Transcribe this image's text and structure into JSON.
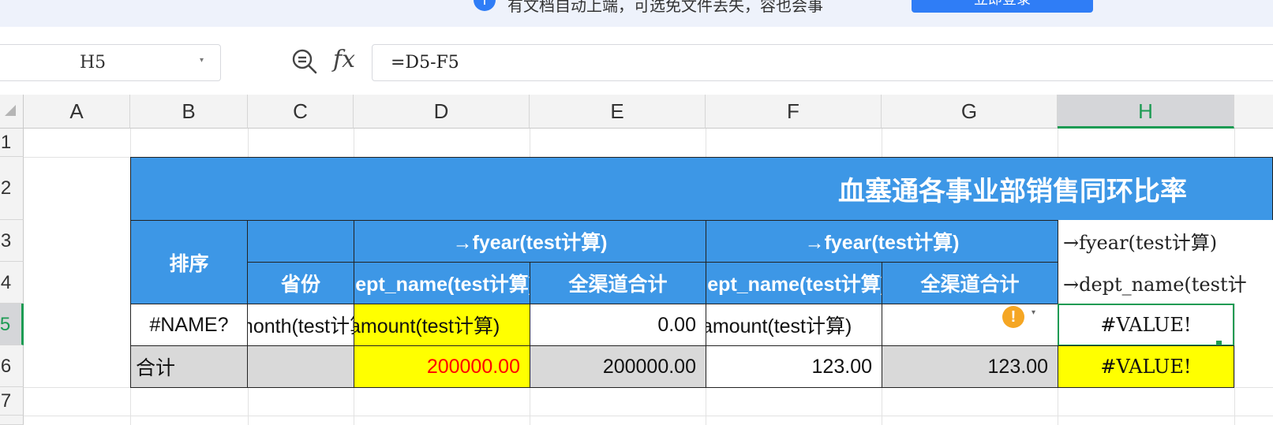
{
  "banner": {
    "info_glyph": "i",
    "text": "有文档自动上端，可选免文件丢失，容也会事",
    "button_label": "立即登录"
  },
  "formula_bar": {
    "name_box": "H5",
    "fx": "fx",
    "formula": "=D5-F5"
  },
  "columns": [
    "A",
    "B",
    "C",
    "D",
    "E",
    "F",
    "G",
    "H"
  ],
  "rows": [
    "1",
    "2",
    "3",
    "4",
    "5",
    "6",
    "7"
  ],
  "active_cell": {
    "column": "H",
    "row": "5"
  },
  "sheet": {
    "title": "血塞通各事业部销售同环比率",
    "header_row3": {
      "b": "排序",
      "d_e": "→fyear(test计算)",
      "f_g": "→fyear(test计算)",
      "h": "→fyear(test计算)"
    },
    "header_row4": {
      "c": "省份",
      "d": "dept_name(test计算)",
      "e": "全渠道合计",
      "f": "dept_name(test计算)",
      "g": "全渠道合计",
      "h": "→dept_name(test计"
    },
    "row5": {
      "b": "#NAME?",
      "c": "month(test计算)",
      "d": "amount(test计算)",
      "e": "0.00",
      "f": "amount(test计算)",
      "g": "",
      "h": "#VALUE!"
    },
    "row6": {
      "b": "合计",
      "c": "",
      "d": "200000.00",
      "e": "200000.00",
      "f": "123.00",
      "g": "123.00",
      "h": "#VALUE!"
    }
  },
  "icons": {
    "zoom": "zoom-out-icon",
    "warning": "warning-icon",
    "warning_glyph": "!",
    "dropdown": "▾"
  },
  "colors": {
    "header_blue": "#3d97e6",
    "highlight_yellow": "#ffff00",
    "total_gray": "#d9d9d9",
    "active_green": "#1c9b53",
    "red_value": "#ff0000"
  }
}
